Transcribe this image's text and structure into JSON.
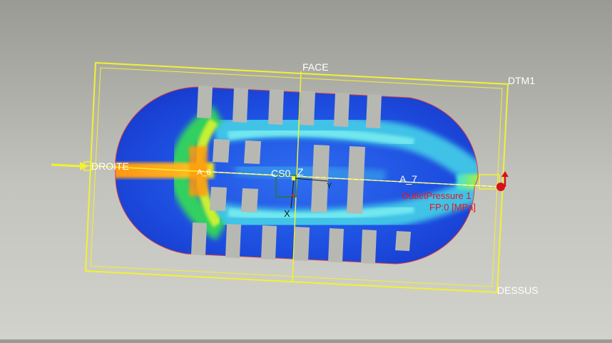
{
  "labels": {
    "face": "FACE",
    "dtm1": "DTM1",
    "dessus": "DESSUS",
    "droite": "DROITE",
    "csys": "CS0",
    "axis_z": "Z",
    "axis_x": "X",
    "axis_y": "Y",
    "axis_a": "A_7",
    "axis_a_left": "A_6"
  },
  "boundary_condition": {
    "name": "OutletPressure 1",
    "value": "FP:0 [MPa]"
  },
  "colors": {
    "datum_plane": "#f2f230",
    "low_velocity": "#1f3fd8",
    "mid_velocity": "#3fd8e8",
    "high_velocity": "#ff9a10",
    "outlet_marker": "#d8101c",
    "background": "#c4c4be"
  }
}
